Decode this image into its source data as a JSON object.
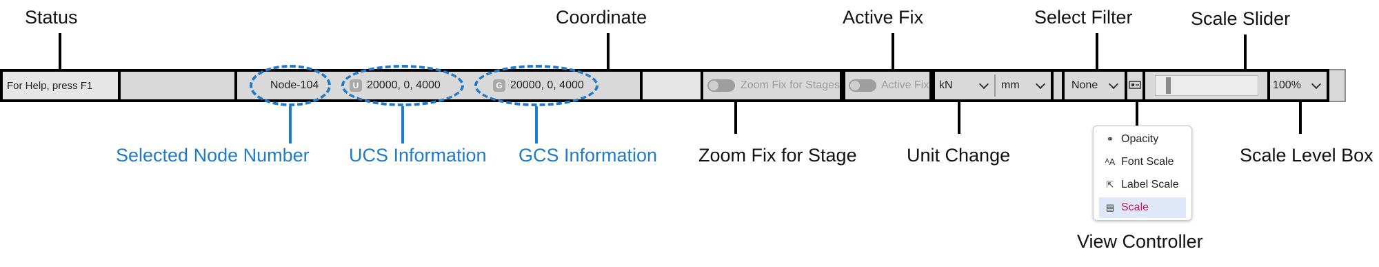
{
  "callouts": {
    "status": "Status",
    "coordinate": "Coordinate",
    "active_fix": "Active Fix",
    "select_filter": "Select Filter",
    "scale_slider": "Scale Slider",
    "selected_node_number": "Selected Node Number",
    "ucs_information": "UCS Information",
    "gcs_information": "GCS Information",
    "zoom_fix_for_stage": "Zoom Fix for Stage",
    "unit_change": "Unit Change",
    "view_controller": "View Controller",
    "scale_level_box": "Scale Level Box"
  },
  "statusbar": {
    "help_text": "For Help, press F1",
    "node": "Node-104",
    "ucs_badge": "U",
    "ucs_coords": "20000, 0, 4000",
    "gcs_badge": "G",
    "gcs_coords": "20000, 0, 4000",
    "zoom_fix_label": "Zoom Fix for Stages",
    "active_fix_label": "Active Fix",
    "force_unit": "kN",
    "length_unit": "mm",
    "select_filter_value": "None",
    "scale_level": "100%"
  },
  "view_menu": {
    "items": [
      {
        "label": "Opacity",
        "icon": "opacity-icon"
      },
      {
        "label": "Font Scale",
        "icon": "font-scale-icon"
      },
      {
        "label": "Label Scale",
        "icon": "label-scale-icon"
      },
      {
        "label": "Scale",
        "icon": "scale-icon",
        "selected": true
      }
    ]
  },
  "colors": {
    "callout_blue": "#1f7bc7",
    "bar_gray": "#d9d9d9",
    "highlight": "#c2185b"
  }
}
